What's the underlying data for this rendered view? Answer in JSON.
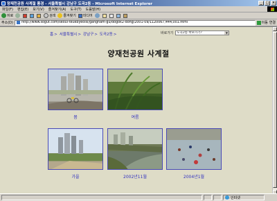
{
  "window": {
    "title": "양재천공원 사계절 풍경 - 서울특별시 강남구 도곡2동 - Microsoft Internet Explorer",
    "minimize": "_",
    "maximize": "□",
    "close": "×"
  },
  "menu": [
    "파일(F)",
    "편집(E)",
    "보기(V)",
    "즐겨찾기(A)",
    "도구(T)",
    "도움말(H)"
  ],
  "toolbar": {
    "back": "뒤로",
    "search": "검색",
    "favorites": "즐겨찾기",
    "media": "미디어"
  },
  "address": {
    "label": "주소(D)",
    "url": "http://www.sogut.com/seoul-teukbyeolsi/gangnam-gu/dogok2-dong/2001-09/1120067,444,001.html",
    "go": "이동",
    "links": "연결"
  },
  "page": {
    "breadcrumb": [
      "홈",
      "서울특별시",
      "강남구",
      "도곡2동"
    ],
    "goto_label": "바로가기",
    "goto_selected": "도곡2동 바로가기?",
    "title": "양재천공원 사계절",
    "photos": [
      {
        "caption": "봄"
      },
      {
        "caption": "여름"
      },
      {
        "caption": "가을"
      },
      {
        "caption": "2002년11월"
      },
      {
        "caption": "2004년1월"
      }
    ]
  },
  "status": {
    "text": "",
    "zone": "인터넷"
  }
}
